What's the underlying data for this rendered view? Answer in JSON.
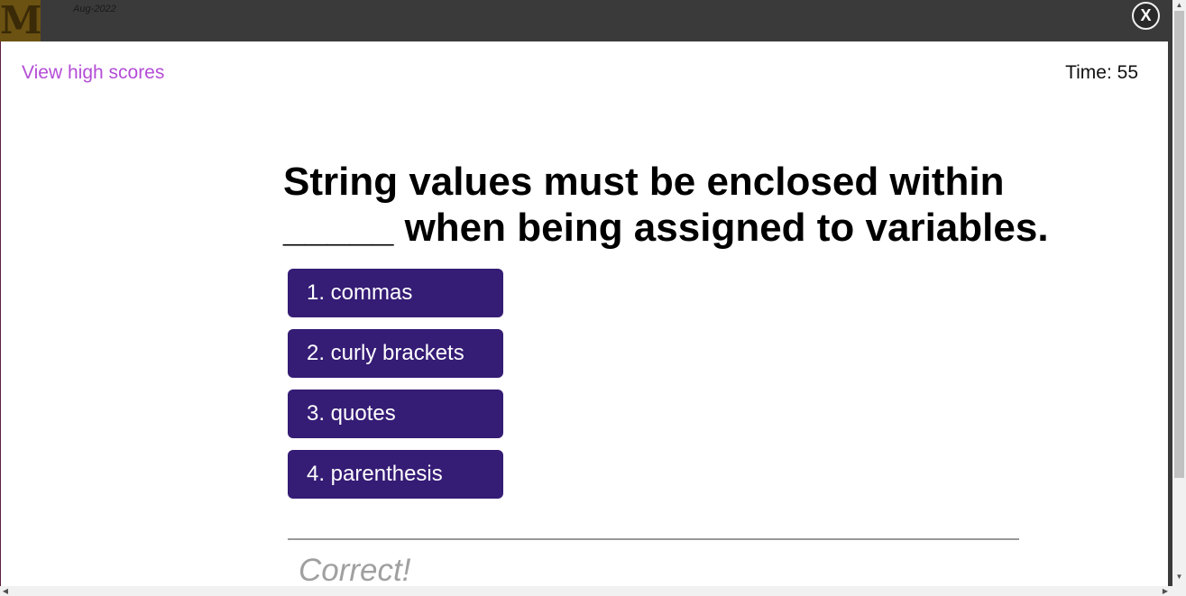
{
  "background": {
    "date": "Aug-2022"
  },
  "close_label": "X",
  "header": {
    "high_scores_label": "View high scores",
    "timer_label": "Time:",
    "timer_value": "55"
  },
  "question": "String values must be enclosed within _____ when being assigned to variables.",
  "answers": [
    {
      "label": "1.  commas"
    },
    {
      "label": "2. curly brackets"
    },
    {
      "label": "3. quotes"
    },
    {
      "label": "4. parenthesis"
    }
  ],
  "feedback": "Correct!",
  "colors": {
    "answer_bg": "#351c75",
    "link": "#b44dd6",
    "feedback": "#a0a0a0"
  },
  "icons": {
    "close": "close-icon",
    "scroll_up": "triangle-up",
    "scroll_down": "triangle-down",
    "scroll_left": "triangle-left",
    "scroll_right": "triangle-right"
  }
}
